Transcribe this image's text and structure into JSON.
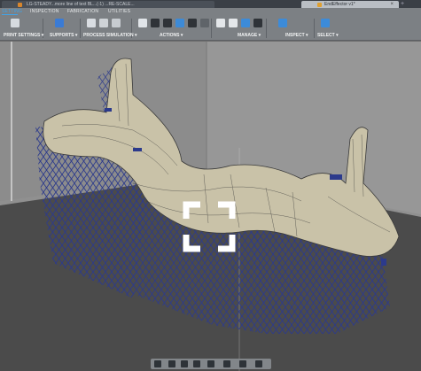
{
  "window": {
    "document_tab": "LG-STEADY...more line of text BL...(-1) ...RE-SCALE...",
    "active_tab": "EndEffector v1*",
    "close_glyph": "×",
    "new_tab_glyph": "+"
  },
  "toolbar": {
    "tabs": [
      "SETTING",
      "INSPECTION",
      "FABRICATION",
      "UTILITIES"
    ],
    "active_tab_index": 0,
    "groups": [
      "PRINT SETTINGS ▾",
      "SUPPORTS ▾",
      "PROCESS SIMULATION ▾",
      "ACTIONS ▾",
      "MANAGE ▾",
      "INSPECT ▾",
      "SELECT ▾"
    ]
  },
  "viewport": {
    "fullscreen_icon": "expand-fullscreen-icon",
    "support_color": "#2c3a8c",
    "part_color": "#c9c2a8",
    "floor_color": "#4b4b4b",
    "wall_color": "#8f8f8f"
  },
  "navbar": {
    "icons": [
      "orbit-icon",
      "pan-icon",
      "zoom-icon",
      "fit-icon",
      "display-icon",
      "grid-icon",
      "viewport-icon",
      "more-icon"
    ]
  }
}
